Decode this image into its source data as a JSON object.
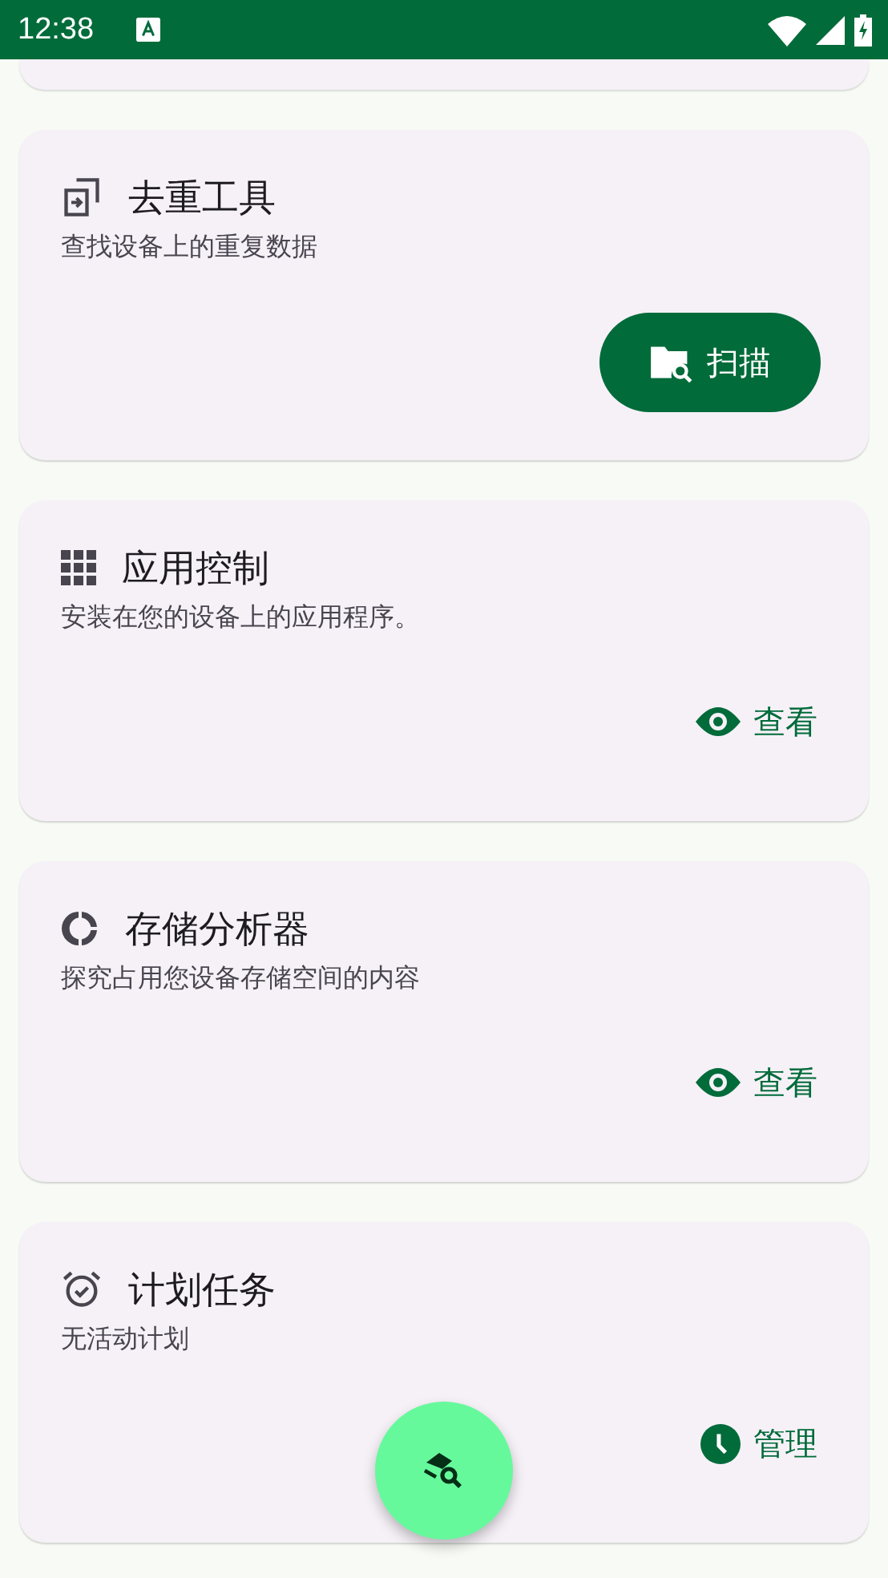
{
  "status_bar": {
    "time": "12:38"
  },
  "cards": [
    {
      "kind": "duplicates",
      "title": "去重工具",
      "description": "查找设备上的重复数据",
      "action": {
        "kind": "filled",
        "label": "扫描"
      }
    },
    {
      "kind": "apps",
      "title": "应用控制",
      "description": "安装在您的设备上的应用程序。",
      "action": {
        "kind": "text",
        "label": "查看"
      }
    },
    {
      "kind": "storage",
      "title": "存储分析器",
      "description": "探究占用您设备存储空间的内容",
      "action": {
        "kind": "text",
        "label": "查看"
      }
    },
    {
      "kind": "schedule",
      "title": "计划任务",
      "description": "无活动计划",
      "action": {
        "kind": "text",
        "label": "管理"
      }
    }
  ]
}
